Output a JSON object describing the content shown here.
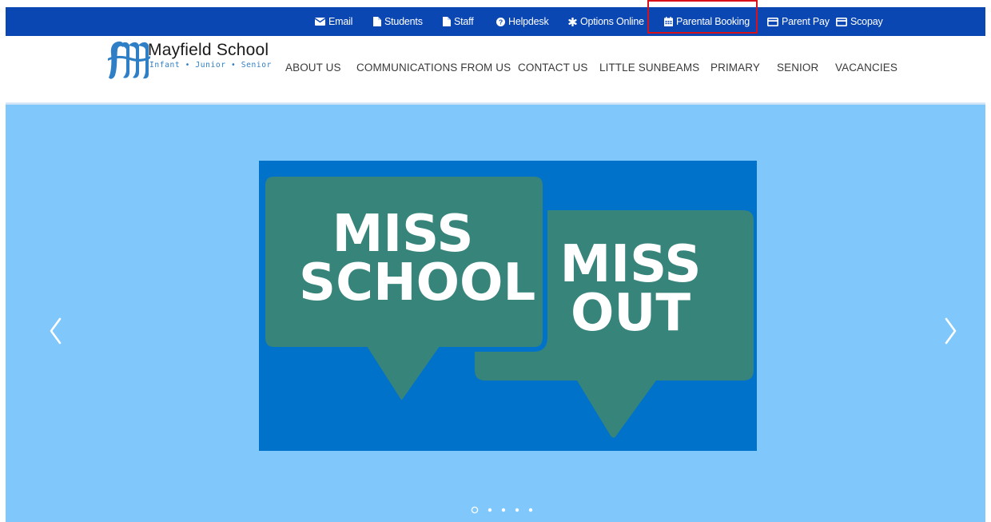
{
  "topbar": {
    "items": [
      {
        "label": "Email",
        "icon": "envelope-icon"
      },
      {
        "label": "Students",
        "icon": "file-icon"
      },
      {
        "label": "Staff",
        "icon": "file-icon"
      },
      {
        "label": "Helpdesk",
        "icon": "question-circle-icon"
      },
      {
        "label": "Options Online",
        "icon": "asterisk-icon"
      },
      {
        "label": "Parental Booking",
        "icon": "calendar-icon"
      },
      {
        "label": "Parent Pay",
        "icon": "credit-card-icon"
      },
      {
        "label": "Scopay",
        "icon": "credit-card-icon"
      }
    ],
    "highlighted_item": "Parental Booking"
  },
  "logo": {
    "title": "Mayfield School",
    "subtitle": "Infant • Junior • Senior"
  },
  "nav": {
    "items": [
      "ABOUT US",
      "COMMUNICATIONS FROM US",
      "CONTACT US",
      "LITTLE SUNBEAMS",
      "PRIMARY",
      "SENIOR",
      "VACANCIES"
    ]
  },
  "hero": {
    "slide": {
      "left_bubble_line1": "MISS",
      "left_bubble_line2": "SCHOOL",
      "right_bubble_line1": "MISS",
      "right_bubble_line2": "OUT"
    },
    "prev_icon": "chevron-left-icon",
    "next_icon": "chevron-right-icon",
    "slide_count": 5,
    "active_slide": 1
  },
  "colors": {
    "topbar": "#0b47b3",
    "hero_bg": "#80c8fb",
    "slide_bg": "#0072c9",
    "bubble": "#37847b",
    "highlight": "#d7101a",
    "logo_blue": "#2f7fc6"
  }
}
